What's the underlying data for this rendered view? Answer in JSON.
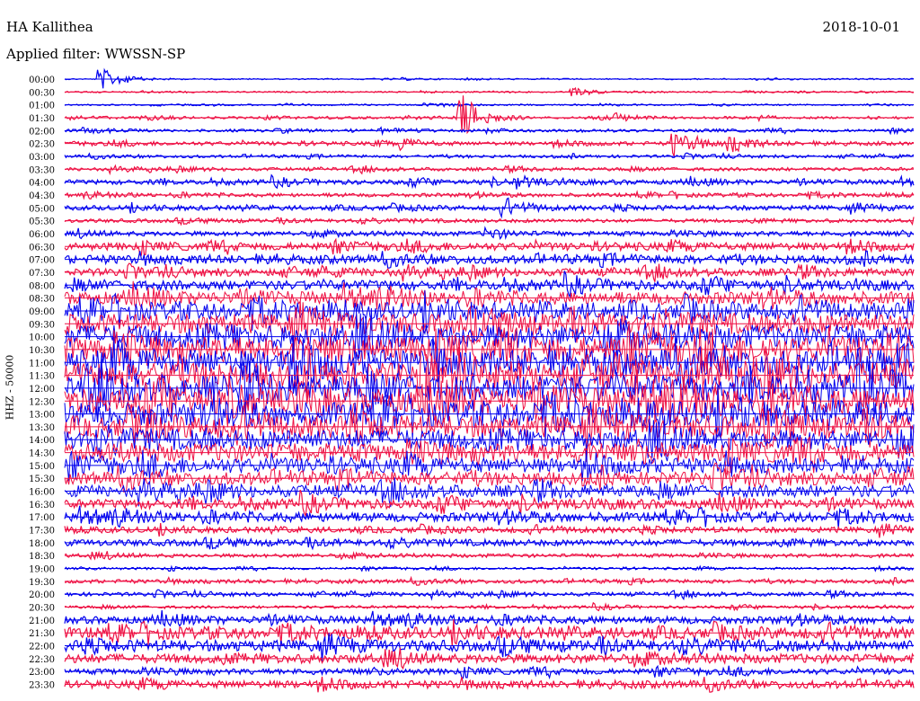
{
  "header": {
    "station": "HA Kallithea",
    "date": "2018-10-01",
    "filter": "Applied filter: WWSSN-SP"
  },
  "chart_data": {
    "type": "line",
    "ylabel": "HHZ - 50000",
    "rows": [
      "00:00",
      "00:30",
      "01:00",
      "01:30",
      "02:00",
      "02:30",
      "03:00",
      "03:30",
      "04:00",
      "04:30",
      "05:00",
      "05:30",
      "06:00",
      "06:30",
      "07:00",
      "07:30",
      "08:00",
      "08:30",
      "09:00",
      "09:30",
      "10:00",
      "10:30",
      "11:00",
      "11:30",
      "12:00",
      "12:30",
      "13:00",
      "13:30",
      "14:00",
      "14:30",
      "15:00",
      "15:30",
      "16:00",
      "16:30",
      "17:00",
      "17:30",
      "18:00",
      "18:30",
      "19:00",
      "19:30",
      "20:00",
      "20:30",
      "21:00",
      "21:30",
      "22:00",
      "22:30",
      "23:00",
      "23:30"
    ],
    "row_colors": [
      "#0000ee",
      "#ee1144"
    ],
    "amplitude": [
      0.6,
      0.7,
      0.8,
      1.2,
      1.5,
      2.0,
      1.5,
      1.8,
      2.5,
      2.0,
      2.5,
      2.0,
      2.5,
      4.0,
      4.5,
      4.0,
      5.0,
      7.0,
      9.0,
      11.0,
      13.0,
      14.0,
      14.0,
      14.0,
      14.0,
      14.0,
      13.0,
      12.0,
      11.0,
      10.0,
      8.0,
      7.0,
      6.5,
      5.0,
      5.0,
      3.0,
      3.5,
      2.0,
      1.2,
      2.0,
      2.0,
      1.5,
      4.0,
      6.0,
      6.0,
      5.0,
      3.0,
      4.0
    ],
    "events": [
      {
        "row": "00:00",
        "minute": 1.3,
        "strength": 12
      },
      {
        "row": "01:30",
        "minute": 14.0,
        "strength": 28
      },
      {
        "row": "00:30",
        "minute": 18.0,
        "strength": 5
      },
      {
        "row": "01:30",
        "minute": 19.5,
        "strength": 4
      },
      {
        "row": "02:30",
        "minute": 21.5,
        "strength": 14
      },
      {
        "row": "02:30",
        "minute": 23.5,
        "strength": 12
      },
      {
        "row": "02:30",
        "minute": 12.0,
        "strength": 5
      },
      {
        "row": "04:00",
        "minute": 16.0,
        "strength": 6
      },
      {
        "row": "05:00",
        "minute": 15.5,
        "strength": 8
      },
      {
        "row": "06:00",
        "minute": 15.0,
        "strength": 6
      }
    ]
  }
}
